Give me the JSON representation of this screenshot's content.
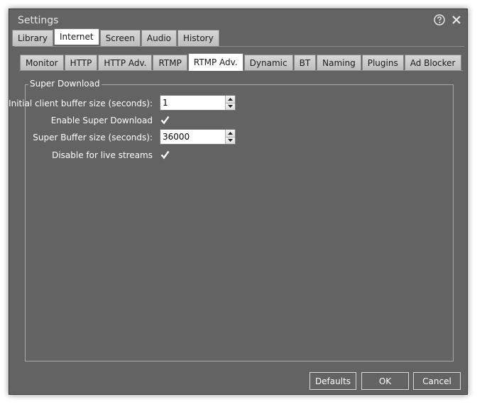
{
  "window": {
    "title": "Settings"
  },
  "tabs_main": [
    {
      "label": "Library",
      "active": false
    },
    {
      "label": "Internet",
      "active": true
    },
    {
      "label": "Screen",
      "active": false
    },
    {
      "label": "Audio",
      "active": false
    },
    {
      "label": "History",
      "active": false
    }
  ],
  "tabs_internet": [
    {
      "label": "Monitor",
      "active": false
    },
    {
      "label": "HTTP",
      "active": false
    },
    {
      "label": "HTTP Adv.",
      "active": false
    },
    {
      "label": "RTMP",
      "active": false
    },
    {
      "label": "RTMP Adv.",
      "active": true
    },
    {
      "label": "Dynamic",
      "active": false
    },
    {
      "label": "BT",
      "active": false
    },
    {
      "label": "Naming",
      "active": false
    },
    {
      "label": "Plugins",
      "active": false
    },
    {
      "label": "Ad Blocker",
      "active": false
    }
  ],
  "super_download": {
    "group_label": "Super Download",
    "initial_buffer": {
      "label": "Initial client buffer size (seconds):",
      "value": "1"
    },
    "enable_super_download": {
      "label": "Enable Super Download",
      "checked": true
    },
    "super_buffer": {
      "label": "Super Buffer size (seconds):",
      "value": "36000"
    },
    "disable_live": {
      "label": "Disable for live streams",
      "checked": true
    }
  },
  "buttons": {
    "defaults": "Defaults",
    "ok": "OK",
    "cancel": "Cancel"
  },
  "icons": {
    "help": "help-icon",
    "close": "close-icon",
    "check": "checkmark-icon"
  },
  "colors": {
    "window_bg": "#636363",
    "tab_active": "#ffffff",
    "text": "#ffffff"
  }
}
